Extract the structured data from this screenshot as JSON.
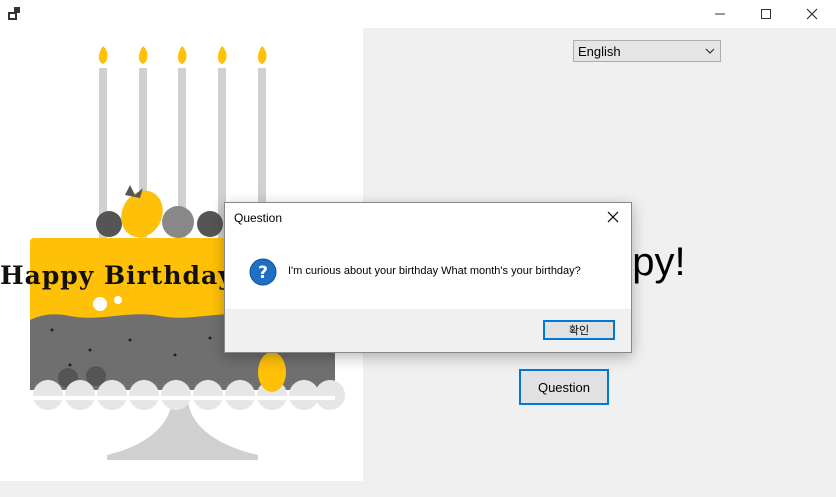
{
  "window": {
    "icon": "app-icon",
    "minimize_icon": "minimize-icon",
    "maximize_icon": "maximize-icon",
    "close_icon": "close-icon"
  },
  "picture": {
    "banner_text": "Happy Birthday",
    "accent_color": "#ffc107"
  },
  "language_select": {
    "value": "English"
  },
  "background_label": "ppy!",
  "question_button": "Question",
  "dialog": {
    "title": "Question",
    "icon": "question-icon",
    "message": "I'm curious about your birthday What month's your birthday?",
    "ok_label": "확인",
    "accent_color": "#0078d7"
  }
}
